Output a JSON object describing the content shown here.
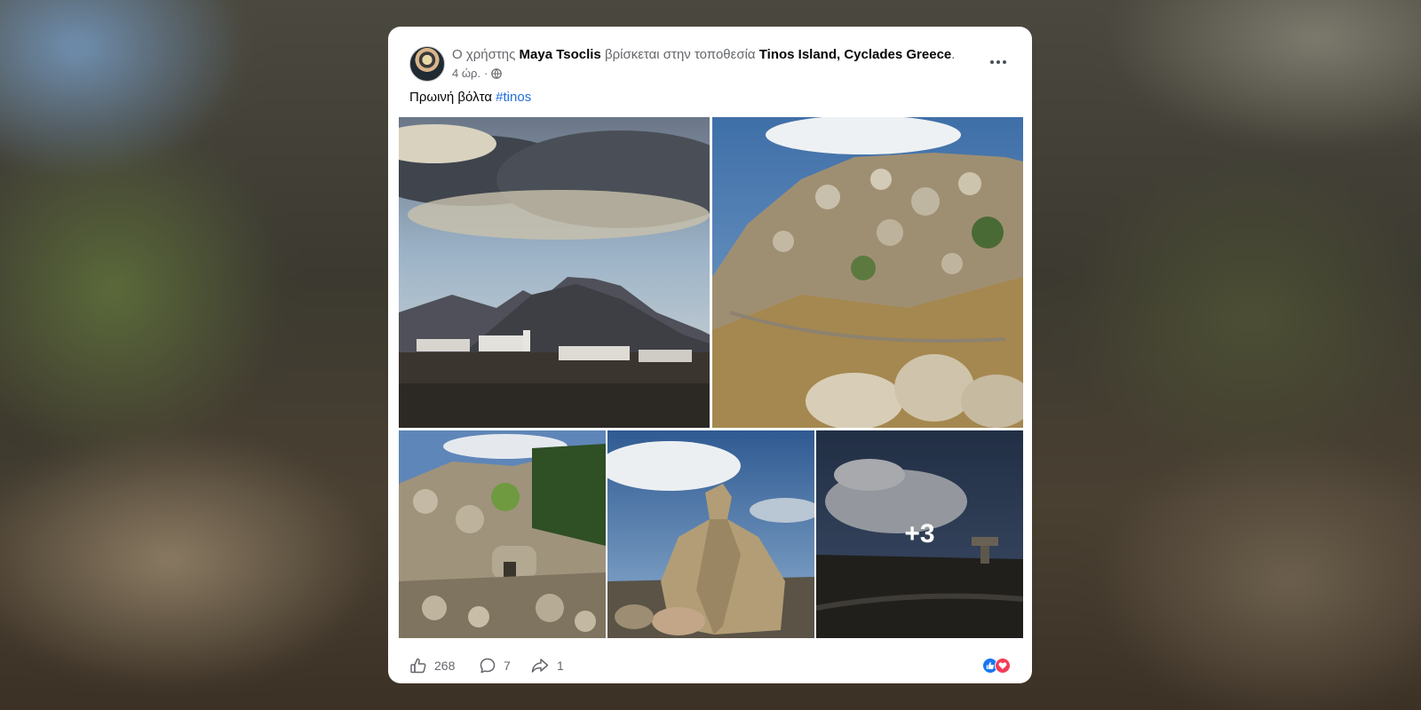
{
  "post": {
    "author": "Maya Tsoclis",
    "prefix": "Ο χρήστης",
    "location_connector": "βρίσκεται στην τοποθεσία",
    "location": "Tinos Island, Cyclades Greece",
    "location_suffix": ".",
    "timestamp": "4 ώρ.",
    "separator": "·",
    "privacy_icon": "globe-icon",
    "caption_text": "Πρωινή βόλτα",
    "hashtag": "#tinos",
    "more_photos_label": "+3"
  },
  "stats": {
    "likes": "268",
    "comments": "7",
    "shares": "1"
  },
  "colors": {
    "hashtag": "#216fdb",
    "like": "#1877f2",
    "love": "#f33e58"
  }
}
